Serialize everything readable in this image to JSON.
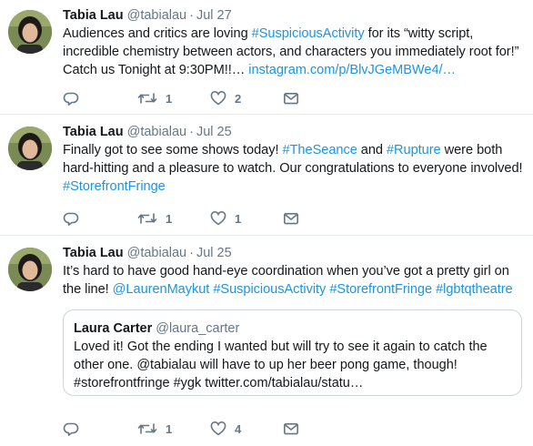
{
  "tweets": [
    {
      "name": "Tabia Lau",
      "handle": "@tabialau",
      "separator": "·",
      "time": "Jul 27",
      "text": [
        {
          "t": "Audiences and critics are loving ",
          "link": false
        },
        {
          "t": "#SuspiciousActivity",
          "link": true
        },
        {
          "t": " for its “witty script, incredible chemistry between actors, and characters you immediately root for!” Catch us Tonight at 9:30PM!!… ",
          "link": false
        },
        {
          "t": "instagram.com/p/BlvJGeMBWe4/…",
          "link": true
        }
      ],
      "retweets": "1",
      "likes": "2"
    },
    {
      "name": "Tabia Lau",
      "handle": "@tabialau",
      "separator": "·",
      "time": "Jul 25",
      "text": [
        {
          "t": "Finally got to see some shows today! ",
          "link": false
        },
        {
          "t": "#TheSeance",
          "link": true
        },
        {
          "t": " and ",
          "link": false
        },
        {
          "t": "#Rupture",
          "link": true
        },
        {
          "t": " were both hard-hitting and a pleasure to watch. Our congratulations to everyone involved! ",
          "link": false
        },
        {
          "t": "#StorefrontFringe",
          "link": true
        }
      ],
      "retweets": "1",
      "likes": "1"
    },
    {
      "name": "Tabia Lau",
      "handle": "@tabialau",
      "separator": "·",
      "time": "Jul 25",
      "text": [
        {
          "t": "It’s hard to have good hand-eye coordination when you’ve got a pretty girl on the line! ",
          "link": false
        },
        {
          "t": "@LaurenMaykut",
          "link": true
        },
        {
          "t": " ",
          "link": false
        },
        {
          "t": "#SuspiciousActivity",
          "link": true
        },
        {
          "t": " ",
          "link": false
        },
        {
          "t": "#StorefrontFringe",
          "link": true
        },
        {
          "t": " ",
          "link": false
        },
        {
          "t": "#lgbtqtheatre",
          "link": true
        }
      ],
      "quote": {
        "name": "Laura Carter",
        "handle": "@laura_carter",
        "text": "Loved it! Got the ending I wanted but will try to see it again to catch the other one.  @tabialau will have to up her beer pong game, though! #storefrontfringe #ygk twitter.com/tabialau/statu…"
      },
      "retweets": "1",
      "likes": "4"
    }
  ],
  "icons": {
    "reply": "reply-icon",
    "retweet": "retweet-icon",
    "like": "heart-icon",
    "message": "envelope-icon"
  },
  "colors": {
    "link": "#1b95e0",
    "muted": "#657786",
    "divider": "#e6ecf0"
  }
}
